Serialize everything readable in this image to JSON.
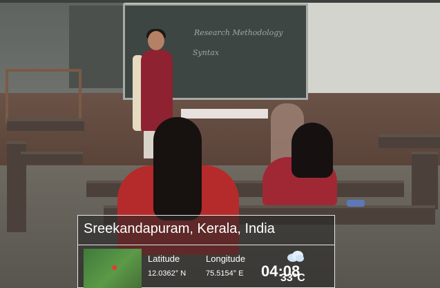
{
  "board": {
    "line1": "Research Methodology",
    "line2": "Syntax"
  },
  "gps": {
    "location": "Sreekandapuram, Kerala, India",
    "latitude_label": "Latitude",
    "longitude_label": "Longitude",
    "latitude": "12.0362° N",
    "longitude": "75.5154° E",
    "time": "04:08",
    "temperature": "33°C"
  },
  "icons": {
    "map": "map-pin-icon",
    "weather": "cloud-icon"
  }
}
